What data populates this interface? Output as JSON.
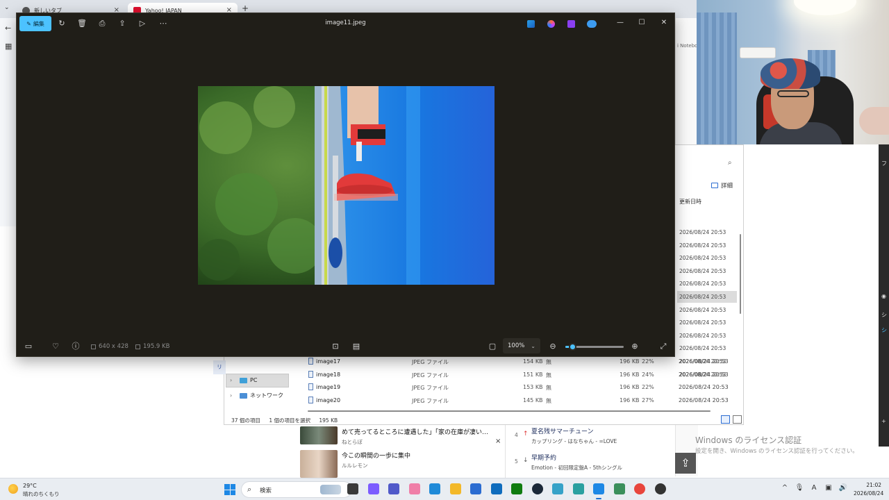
{
  "browser": {
    "tabs": [
      {
        "label": "新しいタブ",
        "close": "×"
      },
      {
        "label": "Yahoo! JAPAN",
        "close": "×"
      }
    ],
    "new_tab": "+",
    "side_fragment": "i Notebo"
  },
  "viewer": {
    "edit_label": "編集",
    "file_name": "image11.jpeg",
    "window_controls": {
      "minimize": "—",
      "maximize": "☐",
      "close": "✕"
    },
    "dimensions": "640 x 428",
    "file_size": "195.9 KB",
    "zoom": "100%",
    "zoom_level": 0.12,
    "icons": [
      "edit-icon",
      "rotate-icon",
      "delete-icon",
      "print-icon",
      "share-icon",
      "slideshow-icon",
      "more-icon",
      "designer-icon",
      "copilot-icon",
      "clipchamp-icon",
      "onedrive-icon",
      "filmstrip-icon",
      "favorite-icon",
      "info-icon",
      "visual-search-icon",
      "ocr-icon",
      "fit-window-icon",
      "zoom-out-icon",
      "zoom-in-icon",
      "fullscreen-icon"
    ],
    "accent": "#4cc2ff"
  },
  "explorer": {
    "detail_label": "詳細",
    "column_modified": "更新日時",
    "dates_top": [
      {
        "text": "2026/08/24 20:53",
        "selected": false
      },
      {
        "text": "2026/08/24 20:53",
        "selected": false
      },
      {
        "text": "2026/08/24 20:53",
        "selected": false
      },
      {
        "text": "2026/08/24 20:53",
        "selected": false
      },
      {
        "text": "2026/08/24 20:53",
        "selected": false
      },
      {
        "text": "2026/08/24 20:53",
        "selected": true
      },
      {
        "text": "2026/08/24 20:53",
        "selected": false
      },
      {
        "text": "2026/08/24 20:53",
        "selected": false
      },
      {
        "text": "2026/08/24 20:53",
        "selected": false
      },
      {
        "text": "2026/08/24 20:53",
        "selected": false
      },
      {
        "text": "2026/08/24 20:53",
        "selected": false
      },
      {
        "text": "2026/08/24 20:53",
        "selected": false
      }
    ],
    "nav": [
      {
        "label": "PC",
        "chevron": "›"
      },
      {
        "label": "ネットワーク",
        "chevron": "›"
      }
    ],
    "left_label": "リ",
    "rows": [
      {
        "name": "image17",
        "type": "JPEG ファイル",
        "size": "154 KB",
        "flag": "無",
        "compressed": "196 KB",
        "ratio": "22%",
        "date": "2026/08/24 20:53"
      },
      {
        "name": "image18",
        "type": "JPEG ファイル",
        "size": "151 KB",
        "flag": "無",
        "compressed": "196 KB",
        "ratio": "24%",
        "date": "2026/08/24 20:53"
      },
      {
        "name": "image19",
        "type": "JPEG ファイル",
        "size": "153 KB",
        "flag": "無",
        "compressed": "196 KB",
        "ratio": "22%",
        "date": "2026/08/24 20:53"
      },
      {
        "name": "image20",
        "type": "JPEG ファイル",
        "size": "145 KB",
        "flag": "無",
        "compressed": "196 KB",
        "ratio": "27%",
        "date": "2026/08/24 20:53"
      }
    ],
    "status": {
      "count": "37 個の項目",
      "selected": "1 個の項目を選択",
      "size": "195 KB"
    }
  },
  "news": {
    "items": [
      {
        "title": "めて売ってるところに遭遇した」「家の在庫が凄い…",
        "source": "ねとらぼ"
      },
      {
        "title": "今この瞬間の一歩に集中",
        "source": "ルルレモン"
      }
    ],
    "close": "×",
    "ranking": [
      {
        "num": "4",
        "arrow": "↑",
        "title": "夏名残サマーチューン",
        "sub": "カップリング - はなちゃん - =LOVE"
      },
      {
        "num": "5",
        "arrow": "↓",
        "title": "早期予約",
        "sub": "Emotion - 初回限定盤A - 5thシングル"
      }
    ],
    "to_top": "⇪"
  },
  "license": {
    "title": "Windows のライセンス認証",
    "subtitle": "設定を開き、Windows のライセンス認証を行ってください。"
  },
  "far_right": {
    "chars": [
      "フ",
      "シ",
      "シ"
    ]
  },
  "taskbar": {
    "weather": {
      "temp": "29°C",
      "condition": "晴れのちくもり"
    },
    "search_label": "検索",
    "apps": [
      "file-explorer-icon",
      "copilot-icon",
      "teams-icon",
      "sticker-icon",
      "edge-icon",
      "folder-icon",
      "store-icon",
      "outlook-icon",
      "xbox-icon",
      "steam-icon",
      "app-icon",
      "app2-icon",
      "photos-icon",
      "notepad-icon",
      "chrome-icon",
      "obs-icon"
    ],
    "tray": [
      "^",
      "🎙",
      "A",
      "▣",
      "🔊"
    ],
    "time": "21:02",
    "date": "2026/08/24"
  }
}
